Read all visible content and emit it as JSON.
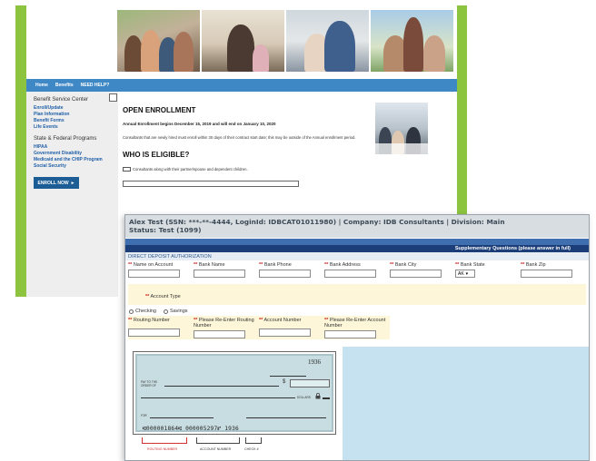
{
  "back_window": {
    "nav": {
      "items": [
        "Home",
        "Benefits",
        "NEED HELP?"
      ]
    },
    "sidebar": {
      "heading": "Benefit Service Center",
      "links": [
        "Enroll/Update",
        "Plan Information",
        "Benefit Forms",
        "Life Events"
      ],
      "heading2": "State & Federal Programs",
      "links2": [
        "HIPAA",
        "Government Disability",
        "Medicaid and the CHIP Program",
        "Social Security"
      ],
      "enroll_button": "ENROLL NOW",
      "enroll_arrow": "►"
    },
    "content": {
      "title": "OPEN ENROLLMENT",
      "annual_line": "Annual Enrollment begins December 15, 2019 and will end on January 10, 2020",
      "paragraph": "Consultants that are newly hired must enroll within 30 days of their contract start date; this may be outside of the Annual enrollment period.",
      "eligible_title": "WHO IS ELIGIBLE?",
      "eligible_line": "Consultants along with their partner/spouse and dependent children."
    }
  },
  "front_window": {
    "header_line1": "Alex Test (SSN: ***-**-4444, LoginId: IDBCAT01011980) | Company: IDB Consultants | Division: Main",
    "header_line2": "Status: Test (1099)",
    "supplementary": "Supplementary Questions (please answer in full)",
    "section": "DIRECT DEPOSIT AUTHORIZATION",
    "required_mark": "**",
    "fields_row1": [
      "Name on Account",
      "Bank Name",
      "Bank Phone",
      "Bank Address",
      "Bank City",
      "Bank State",
      "Bank Zip"
    ],
    "bank_state_value": "AK",
    "select_arrow": "▾",
    "account_type_label": "Account Type",
    "radio_checking": "Checking",
    "radio_savings": "Savings",
    "fields_row2": [
      "Routing Number",
      "Please Re-Enter Routing Number",
      "Account Number",
      "Please Re-Enter Account Number"
    ],
    "check": {
      "number": "1936",
      "micr": "⑆000001864⑆ 000005297⑈ 1936",
      "pay_to": "PAY TO THE ORDER OF",
      "dollar_sign": "$",
      "dollars": "DOLLARS",
      "memo": "FOR",
      "lock_icon": "padlock",
      "routing_label": "ROUTING NUMBER",
      "account_label": "ACCOUNT NUMBER",
      "check_label": "CHECK #"
    },
    "colors": {
      "header_bg": "#d8dde2",
      "header_text": "#3c4a56",
      "blue_bar": "#1c3e78",
      "field_yellow": "#fdf6d8",
      "required_red": "#d02020",
      "panel_blue": "#c6e2f1"
    }
  }
}
